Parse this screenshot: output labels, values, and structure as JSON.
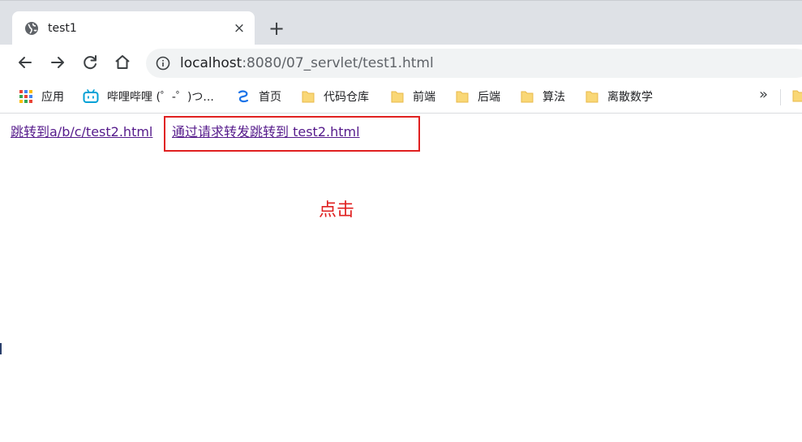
{
  "tab": {
    "title": "test1",
    "close_glyph": "×",
    "new_tab_glyph": "+"
  },
  "toolbar": {
    "url_host": "localhost",
    "url_rest": ":8080/07_servlet/test1.html"
  },
  "bookmarks": {
    "items": [
      {
        "label": "应用",
        "icon": "apps-grid-icon"
      },
      {
        "label": "哔哩哔哩 (゜-゜)つ...",
        "icon": "bilibili-icon"
      },
      {
        "label": "首页",
        "icon": "site-icon"
      },
      {
        "label": "代码仓库",
        "icon": "folder-icon"
      },
      {
        "label": "前端",
        "icon": "folder-icon"
      },
      {
        "label": "后端",
        "icon": "folder-icon"
      },
      {
        "label": "算法",
        "icon": "folder-icon"
      },
      {
        "label": "离散数学",
        "icon": "folder-icon"
      }
    ],
    "more_glyph": "»"
  },
  "page": {
    "link1": "跳转到a/b/c/test2.html",
    "link2": "通过请求转发跳转到 test2.html",
    "annotation": "点击"
  },
  "colors": {
    "link_visited": "#551a8b",
    "annotation_red": "#e02020",
    "tabstrip_bg": "#dee1e6",
    "omnibox_bg": "#f1f3f4",
    "folder_yellow": "#f9d776"
  }
}
